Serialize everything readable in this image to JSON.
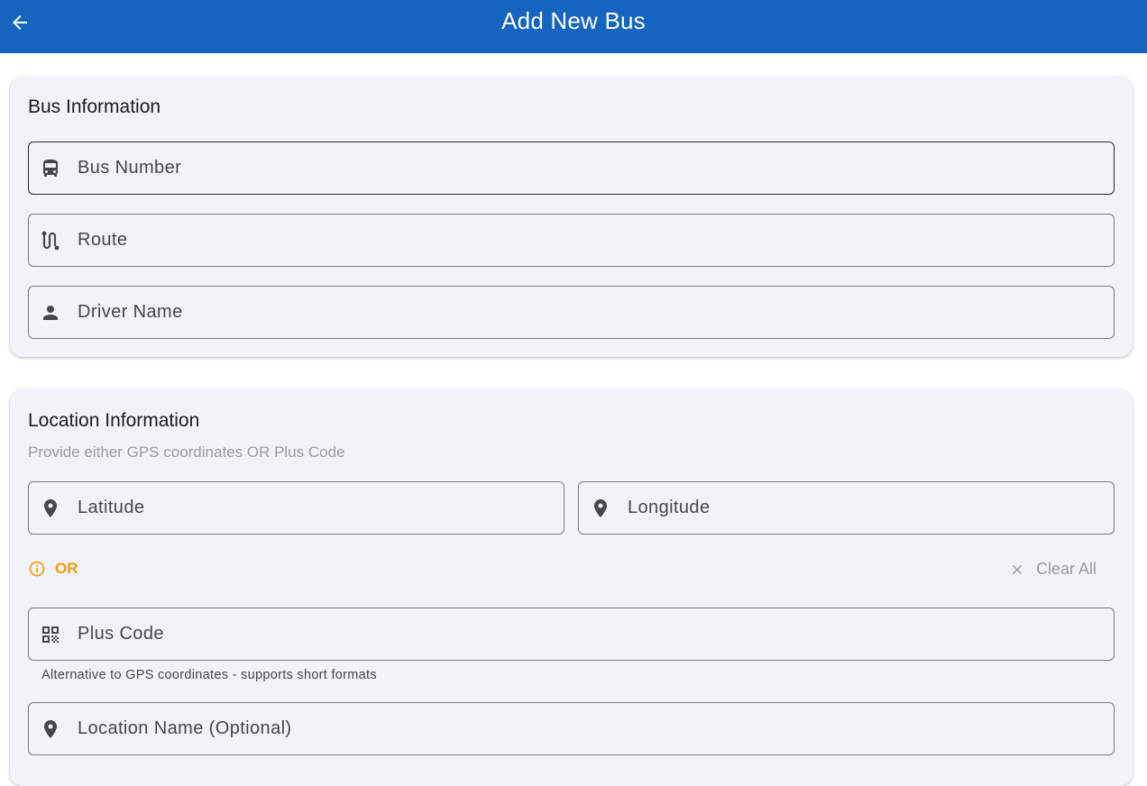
{
  "appbar": {
    "title": "Add New Bus",
    "back_icon": "arrow-back-icon",
    "color": "#1565c0"
  },
  "bus_info": {
    "title": "Bus Information",
    "fields": {
      "bus_number": {
        "placeholder": "Bus Number",
        "icon": "bus-icon"
      },
      "route": {
        "placeholder": "Route",
        "icon": "route-icon"
      },
      "driver_name": {
        "placeholder": "Driver Name",
        "icon": "person-icon"
      }
    }
  },
  "location_info": {
    "title": "Location Information",
    "subtitle": "Provide either GPS coordinates OR Plus Code",
    "latitude": {
      "placeholder": "Latitude",
      "icon": "location-pin-icon"
    },
    "longitude": {
      "placeholder": "Longitude",
      "icon": "location-pin-icon"
    },
    "or_label": "OR",
    "or_icon": "info-icon",
    "or_color": "#f29a13",
    "clear_all_label": "Clear All",
    "clear_all_icon": "close-icon",
    "plus_code": {
      "placeholder": "Plus Code",
      "icon": "qr-code-icon",
      "helper": "Alternative to GPS coordinates - supports short formats"
    },
    "location_name": {
      "placeholder": "Location Name (Optional)",
      "icon": "location-pin-icon"
    }
  }
}
